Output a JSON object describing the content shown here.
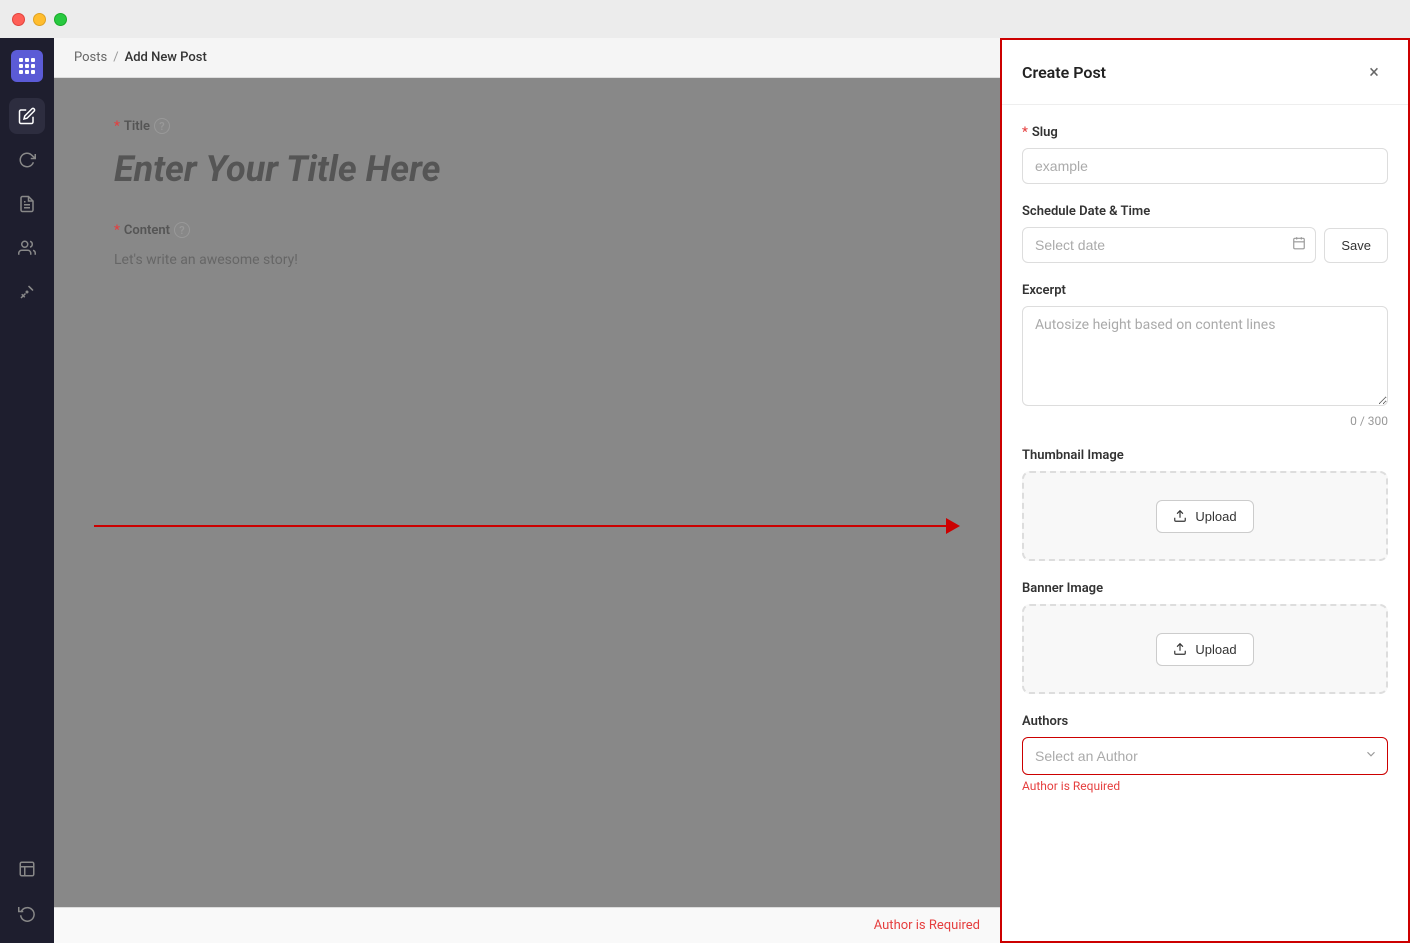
{
  "titlebar": {
    "traffic_lights": [
      "close",
      "minimize",
      "maximize"
    ]
  },
  "sidebar": {
    "logo_label": "App Logo",
    "items": [
      {
        "id": "pen",
        "icon": "✏",
        "label": "Editor",
        "active": true
      },
      {
        "id": "refresh",
        "icon": "↺",
        "label": "Refresh",
        "active": false
      },
      {
        "id": "document",
        "icon": "☰",
        "label": "Documents",
        "active": false
      },
      {
        "id": "users",
        "icon": "👥",
        "label": "Users",
        "active": false
      },
      {
        "id": "tools",
        "icon": "✂",
        "label": "Tools",
        "active": false
      }
    ],
    "bottom_items": [
      {
        "id": "note",
        "icon": "📋",
        "label": "Notes",
        "active": false
      },
      {
        "id": "settings",
        "icon": "↺",
        "label": "Settings",
        "active": false
      }
    ]
  },
  "breadcrumb": {
    "parent": "Posts",
    "separator": "/",
    "current": "Add New Post"
  },
  "editor": {
    "title_label": "Title",
    "title_placeholder": "Enter Your Title Here",
    "content_label": "Content",
    "content_placeholder": "Let's write an awesome story!",
    "arrow_color": "#cc0000"
  },
  "editor_bottom": {
    "author_required": "Author is Required"
  },
  "panel": {
    "title": "Create Post",
    "close_label": "×",
    "fields": {
      "slug": {
        "label": "Slug",
        "required": true,
        "placeholder": "example",
        "value": ""
      },
      "schedule": {
        "label": "Schedule Date & Time",
        "required": false,
        "date_placeholder": "Select date",
        "save_label": "Save"
      },
      "excerpt": {
        "label": "Excerpt",
        "required": false,
        "placeholder": "Autosize height based on content lines",
        "value": "",
        "char_count": "0 / 300"
      },
      "thumbnail": {
        "label": "Thumbnail Image",
        "upload_label": "Upload"
      },
      "banner": {
        "label": "Banner Image",
        "upload_label": "Upload"
      },
      "authors": {
        "label": "Authors",
        "required": false,
        "placeholder": "Select an Author",
        "error": "Author is Required",
        "options": [
          "Select an Author"
        ]
      }
    }
  }
}
